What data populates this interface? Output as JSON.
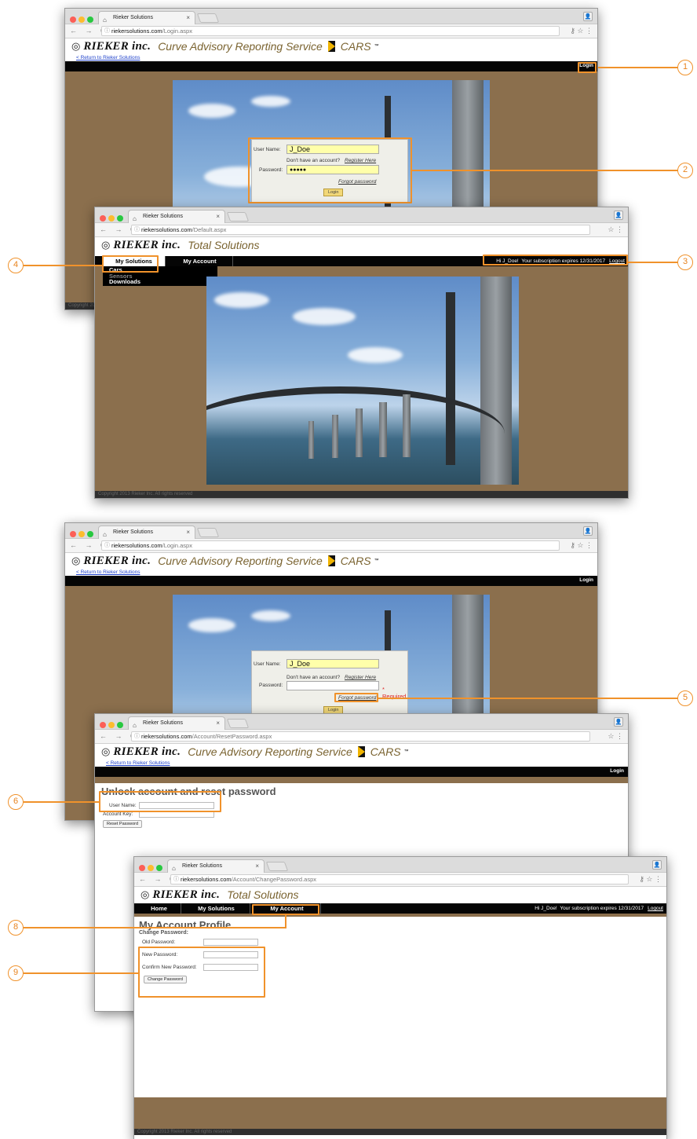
{
  "browser": {
    "tab_title": "Rieker Solutions",
    "domain": "riekersolutions.com",
    "paths": {
      "login": "/Login.aspx",
      "default": "/Default.aspx",
      "reset": "/Account/ResetPassword.aspx",
      "change": "/Account/ChangePassword.aspx"
    }
  },
  "brand": {
    "company": "RIEKER inc.",
    "cars_title": "Curve Advisory Reporting Service",
    "cars_short": "CARS",
    "tm": "™",
    "total_solutions": "Total Solutions"
  },
  "links": {
    "return": "< Return to Rieker Solutions",
    "login": "Login",
    "logout": "Logout",
    "register": "Register Here",
    "forgot": "Forgot password"
  },
  "login_form": {
    "username_label": "User Name:",
    "username_value": "J_Doe",
    "no_account": "Don't have an account?",
    "password_label": "Password:",
    "password_masked": "●●●●●",
    "login_button": "Login",
    "required": "* Required"
  },
  "menu": {
    "home": "Home",
    "my_solutions": "My Solutions",
    "my_account": "My Account",
    "items": [
      "Cars",
      "Sensors",
      "Downloads"
    ]
  },
  "user": {
    "greeting": "Hi J_Doe!",
    "subscription": "Your subscription expires 12/31/2017"
  },
  "reset": {
    "heading": "Unlock account and reset password",
    "username_label": "User Name:",
    "account_key_label": "Account Key:",
    "button": "Reset Password"
  },
  "profile": {
    "heading": "My Account Profile",
    "subheading": "Change Password:",
    "old": "Old Password:",
    "new": "New Password:",
    "confirm": "Confirm New Password:",
    "button": "Change Password"
  },
  "footer": "Copyright 2013 Rieker Inc. All rights reserved",
  "footer_cut": "Copyright 20",
  "callouts": [
    "1",
    "2",
    "3",
    "4",
    "5",
    "6",
    "8",
    "9"
  ],
  "colors": {
    "accent": "#f0922b",
    "brown": "#8b6f4d",
    "field_yellow": "#ffffaa",
    "link_green": "#55aa33"
  }
}
